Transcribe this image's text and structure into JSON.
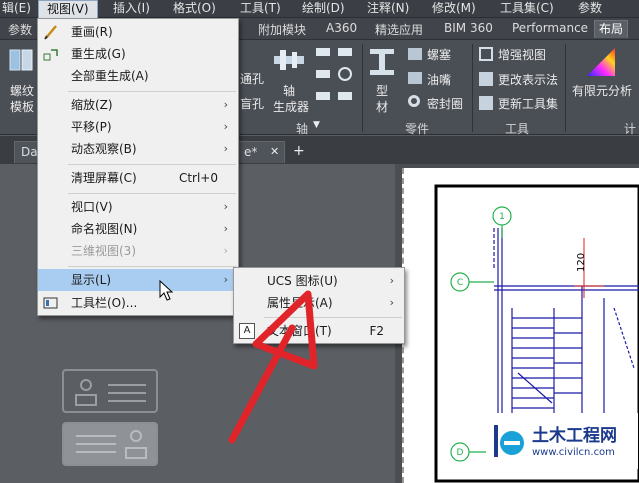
{
  "menubar": {
    "items": [
      "辑(E)",
      "视图(V)",
      "插入(I)",
      "格式(O)",
      "工具(T)",
      "绘制(D)",
      "注释(N)",
      "修改(M)",
      "工具集(C)",
      "参数"
    ]
  },
  "ribbon_tabs": [
    "参数",
    "附加模块",
    "A360",
    "精选应用",
    "BIM 360",
    "Performance",
    "布局"
  ],
  "ribbon": {
    "left_labels": [
      "螺纹",
      "模板"
    ],
    "hole_labels": [
      "通孔",
      "盲孔"
    ],
    "axis_gen": [
      "轴",
      "生成器"
    ],
    "struct_material": [
      "型",
      "材"
    ],
    "parts": [
      "螺塞",
      "油嘴",
      "密封圈"
    ],
    "tools": [
      "增强视图",
      "更改表示法",
      "更新工具集"
    ],
    "fea": "有限元分析",
    "panels": {
      "axis": "轴",
      "parts": "零件",
      "tools": "工具",
      "calc": "计"
    }
  },
  "doc_tabs": [
    "Da",
    "e*"
  ],
  "view_menu": {
    "items": [
      {
        "label": "重画(R)",
        "shortcut": "",
        "submenu": false,
        "disabled": false
      },
      {
        "label": "重生成(G)",
        "shortcut": "",
        "submenu": false,
        "disabled": false
      },
      {
        "label": "全部重生成(A)",
        "shortcut": "",
        "submenu": false,
        "disabled": false
      },
      {
        "label": "缩放(Z)",
        "shortcut": "",
        "submenu": true,
        "disabled": false
      },
      {
        "label": "平移(P)",
        "shortcut": "",
        "submenu": true,
        "disabled": false
      },
      {
        "label": "动态观察(B)",
        "shortcut": "",
        "submenu": true,
        "disabled": false
      },
      {
        "label": "清理屏幕(C)",
        "shortcut": "Ctrl+0",
        "submenu": false,
        "disabled": false
      },
      {
        "label": "视口(V)",
        "shortcut": "",
        "submenu": true,
        "disabled": false
      },
      {
        "label": "命名视图(N)",
        "shortcut": "",
        "submenu": true,
        "disabled": false
      },
      {
        "label": "三维视图(3)",
        "shortcut": "",
        "submenu": true,
        "disabled": true
      },
      {
        "label": "显示(L)",
        "shortcut": "",
        "submenu": true,
        "disabled": false
      },
      {
        "label": "工具栏(O)...",
        "shortcut": "",
        "submenu": false,
        "disabled": false
      }
    ]
  },
  "display_submenu": {
    "items": [
      {
        "label": "UCS 图标(U)",
        "shortcut": "",
        "submenu": true
      },
      {
        "label": "属性显示(A)",
        "shortcut": "",
        "submenu": true
      },
      {
        "label": "文本窗口(T)",
        "shortcut": "F2",
        "submenu": false
      }
    ]
  },
  "drawing": {
    "grid_labels": [
      "1",
      "C",
      "D"
    ],
    "dimension": "120"
  },
  "watermark": {
    "title": "土木工程网",
    "url": "www.civilcn.com"
  },
  "colors": {
    "menu_hover": "#a9cdf0",
    "arrow_red": "#e0242a",
    "drawing_blue": "#1a1aa8",
    "grid_green": "#22b14c",
    "accent_red": "#d62020"
  }
}
